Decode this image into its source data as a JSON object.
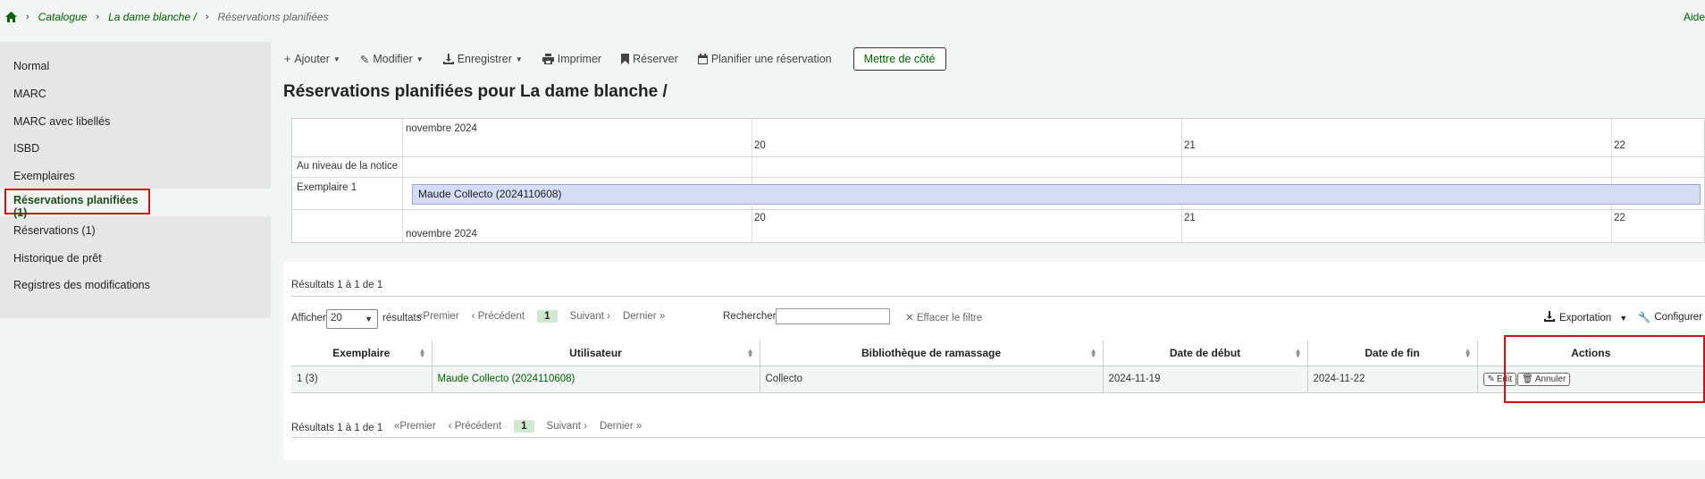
{
  "breadcrumb": {
    "items": [
      "Catalogue",
      "La dame blanche /"
    ],
    "current": "Réservations planifiées"
  },
  "help": "Aide",
  "sidebar": {
    "items": [
      "Normal",
      "MARC",
      "MARC avec libellés",
      "ISBD",
      "Exemplaires"
    ],
    "active": "Réservations planifiées (1)",
    "items_after": [
      "Réservations (1)",
      "Historique de prêt",
      "Registres des modifications"
    ]
  },
  "toolbar": {
    "add": "Ajouter",
    "edit": "Modifier",
    "save": "Enregistrer",
    "print": "Imprimer",
    "hold": "Réserver",
    "schedule": "Planifier une réservation",
    "set_aside": "Mettre de côté"
  },
  "title": "Réservations planifiées pour La dame blanche /",
  "timeline": {
    "month_top": "novembre 2024",
    "month_bottom": "novembre 2024",
    "days": [
      "20",
      "21",
      "22"
    ],
    "rows": [
      "Au niveau de la notice",
      "Exemplaire 1"
    ],
    "booking": "Maude Collecto (2024110608)"
  },
  "results": {
    "summary_top": "Résultats 1 à 1 de 1",
    "summary_bottom": "Résultats 1 à 1 de 1",
    "show_label": "Afficher",
    "show_value": "20",
    "results_label": "résultats",
    "pager": {
      "first": "Premier",
      "previous": "Précédent",
      "page": "1",
      "next": "Suivant",
      "last": "Dernier"
    },
    "search_label": "Rechercher :",
    "clear_filter": "Effacer le filtre",
    "export": "Exportation",
    "configure": "Configurer",
    "columns": [
      "Exemplaire",
      "Utilisateur",
      "Bibliothèque de ramassage",
      "Date de début",
      "Date de fin",
      "Actions"
    ],
    "row": {
      "item": "1 (3)",
      "patron": "Maude Collecto (2024110608)",
      "library": "Collecto",
      "start": "2024-11-19",
      "end": "2024-11-22",
      "edit": "Edit",
      "cancel": "Annuler"
    }
  }
}
